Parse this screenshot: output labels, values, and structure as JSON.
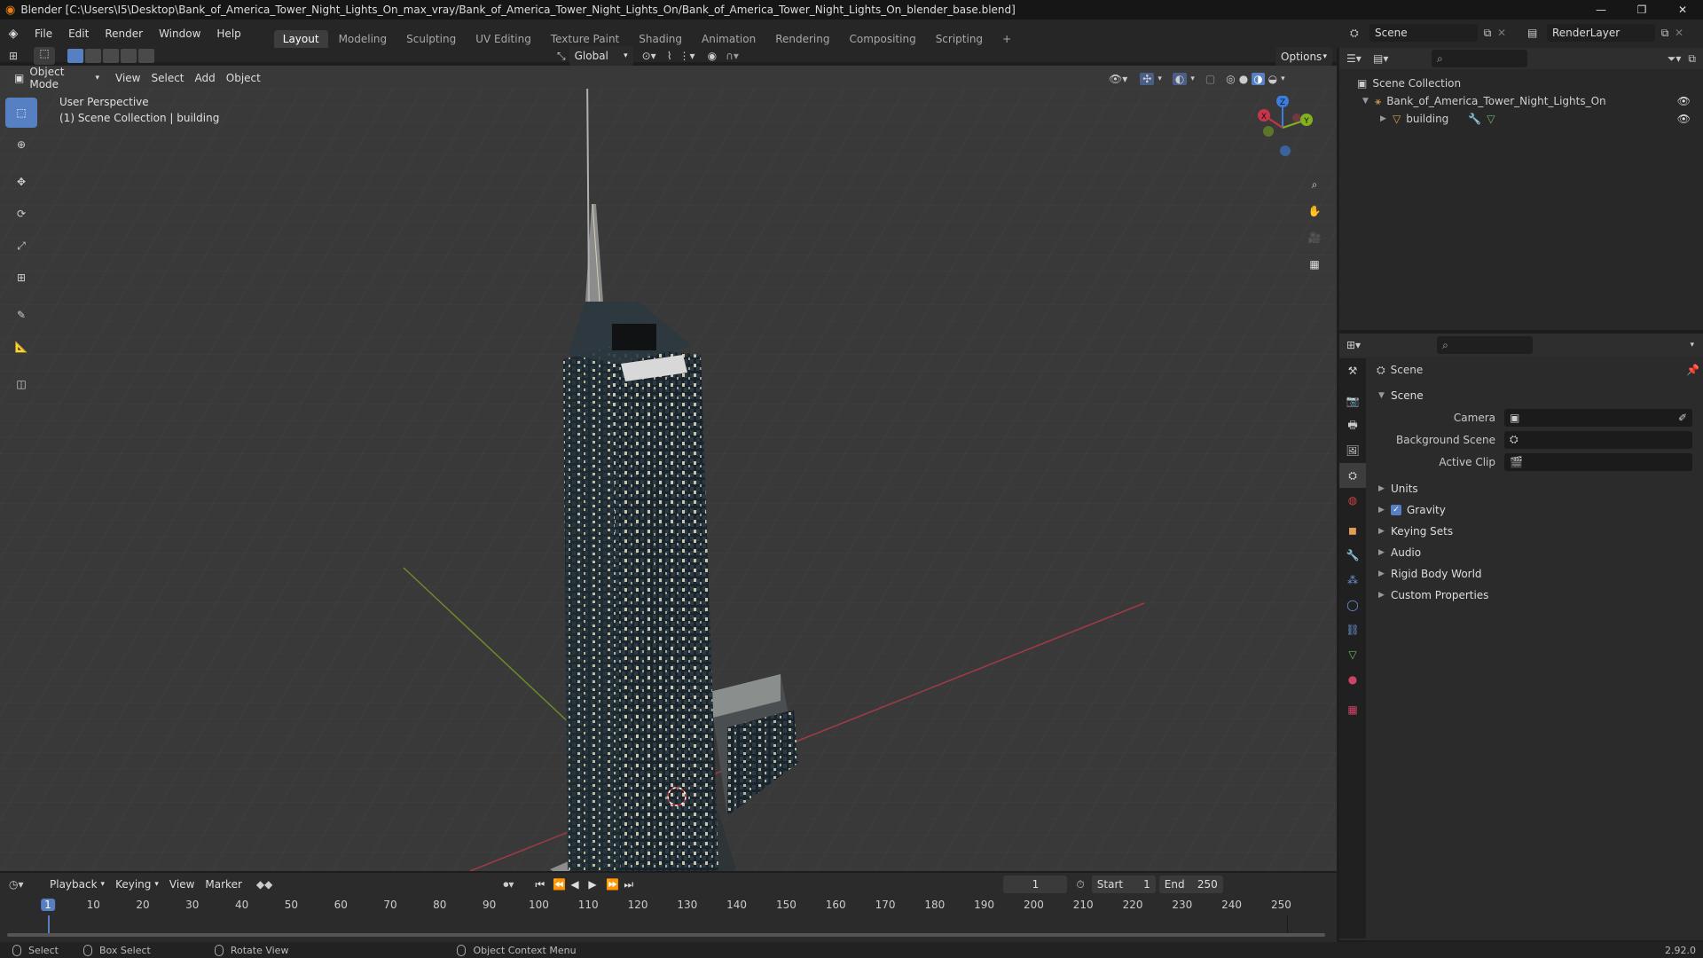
{
  "window": {
    "title": "Blender [C:\\Users\\I5\\Desktop\\Bank_of_America_Tower_Night_Lights_On_max_vray/Bank_of_America_Tower_Night_Lights_On/Bank_of_America_Tower_Night_Lights_On_blender_base.blend]",
    "minimize": "—",
    "restore": "❐",
    "close": "✕"
  },
  "menu": {
    "items": [
      "File",
      "Edit",
      "Render",
      "Window",
      "Help"
    ]
  },
  "workspaces": {
    "tabs": [
      "Layout",
      "Modeling",
      "Sculpting",
      "UV Editing",
      "Texture Paint",
      "Shading",
      "Animation",
      "Rendering",
      "Compositing",
      "Scripting"
    ],
    "add": "+"
  },
  "topright": {
    "scene": "Scene",
    "renderlayer": "RenderLayer"
  },
  "viewport_header": {
    "mode": "Object Mode",
    "menus": [
      "View",
      "Select",
      "Add",
      "Object"
    ],
    "orientation": "Global",
    "options": "Options"
  },
  "viewport": {
    "perspective": "User Perspective",
    "collection": "(1) Scene Collection | building",
    "gizmo": {
      "x": "X",
      "y": "Y",
      "z": "Z"
    }
  },
  "outliner": {
    "root": "Scene Collection",
    "items": [
      {
        "label": "Bank_of_America_Tower_Night_Lights_On"
      },
      {
        "label": "building"
      }
    ]
  },
  "properties": {
    "header": "Scene",
    "panel_title": "Scene",
    "fields": [
      {
        "label": "Camera"
      },
      {
        "label": "Background Scene"
      },
      {
        "label": "Active Clip"
      }
    ],
    "panels": [
      "Units",
      "Gravity",
      "Keying Sets",
      "Audio",
      "Rigid Body World",
      "Custom Properties"
    ],
    "gravity_checked": true
  },
  "timeline": {
    "menus": [
      "Playback",
      "Keying",
      "View",
      "Marker"
    ],
    "current_frame": "1",
    "start_label": "Start",
    "start": "1",
    "end_label": "End",
    "end": "250",
    "ticks": [
      "1",
      "10",
      "20",
      "30",
      "40",
      "50",
      "60",
      "70",
      "80",
      "90",
      "100",
      "110",
      "120",
      "130",
      "140",
      "150",
      "160",
      "170",
      "180",
      "190",
      "200",
      "210",
      "220",
      "230",
      "240",
      "250"
    ]
  },
  "statusbar": {
    "select": "Select",
    "box_select": "Box Select",
    "rotate": "Rotate View",
    "context": "Object Context Menu",
    "version": "2.92.0"
  },
  "colors": {
    "accent": "#5680c2",
    "x_axis": "#c7354a",
    "y_axis": "#82b01e",
    "z_axis": "#3c7ee0"
  }
}
